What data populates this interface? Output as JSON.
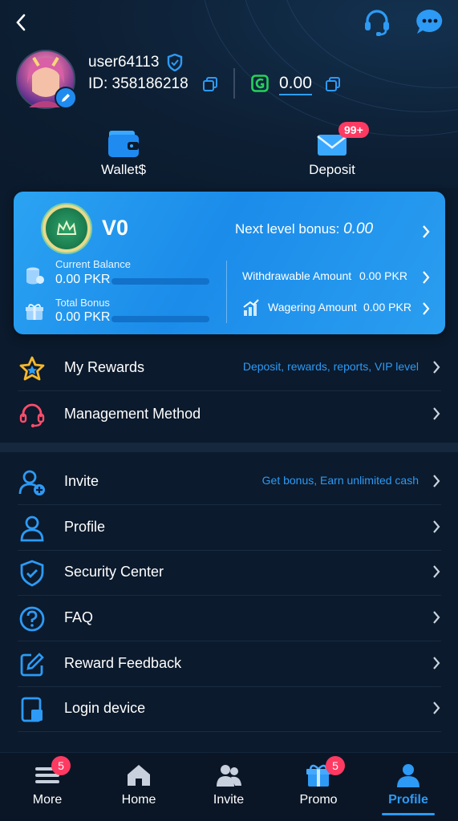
{
  "user": {
    "name": "user64113",
    "id_label": "ID: 358186218",
    "balance": "0.00"
  },
  "quick_actions": {
    "wallet_label": "Wallet$",
    "deposit_label": "Deposit",
    "deposit_badge": "99+"
  },
  "vip": {
    "level": "V0",
    "next_bonus_label": "Next level bonus: ",
    "next_bonus_value": "0.00",
    "current_balance_label": "Current Balance",
    "current_balance_value": "0.00 PKR",
    "total_bonus_label": "Total Bonus",
    "total_bonus_value": "0.00 PKR",
    "withdrawable_label": "Withdrawable Amount",
    "withdrawable_value": "0.00 PKR",
    "wagering_label": "Wagering Amount",
    "wagering_value": "0.00 PKR"
  },
  "menu_a": [
    {
      "label": "My Rewards",
      "hint": "Deposit, rewards, reports, VIP level"
    },
    {
      "label": "Management Method",
      "hint": ""
    }
  ],
  "menu_b": [
    {
      "label": "Invite",
      "hint": "Get bonus, Earn unlimited cash"
    },
    {
      "label": "Profile",
      "hint": ""
    },
    {
      "label": "Security Center",
      "hint": ""
    },
    {
      "label": "FAQ",
      "hint": ""
    },
    {
      "label": "Reward Feedback",
      "hint": ""
    },
    {
      "label": "Login device",
      "hint": ""
    }
  ],
  "tabs": [
    {
      "label": "More",
      "badge": "5"
    },
    {
      "label": "Home",
      "badge": ""
    },
    {
      "label": "Invite",
      "badge": ""
    },
    {
      "label": "Promo",
      "badge": "5"
    },
    {
      "label": "Profile",
      "badge": ""
    }
  ],
  "colors": {
    "accent": "#2d9af5",
    "badge": "#ff3a62",
    "background": "#0b1a2c"
  }
}
